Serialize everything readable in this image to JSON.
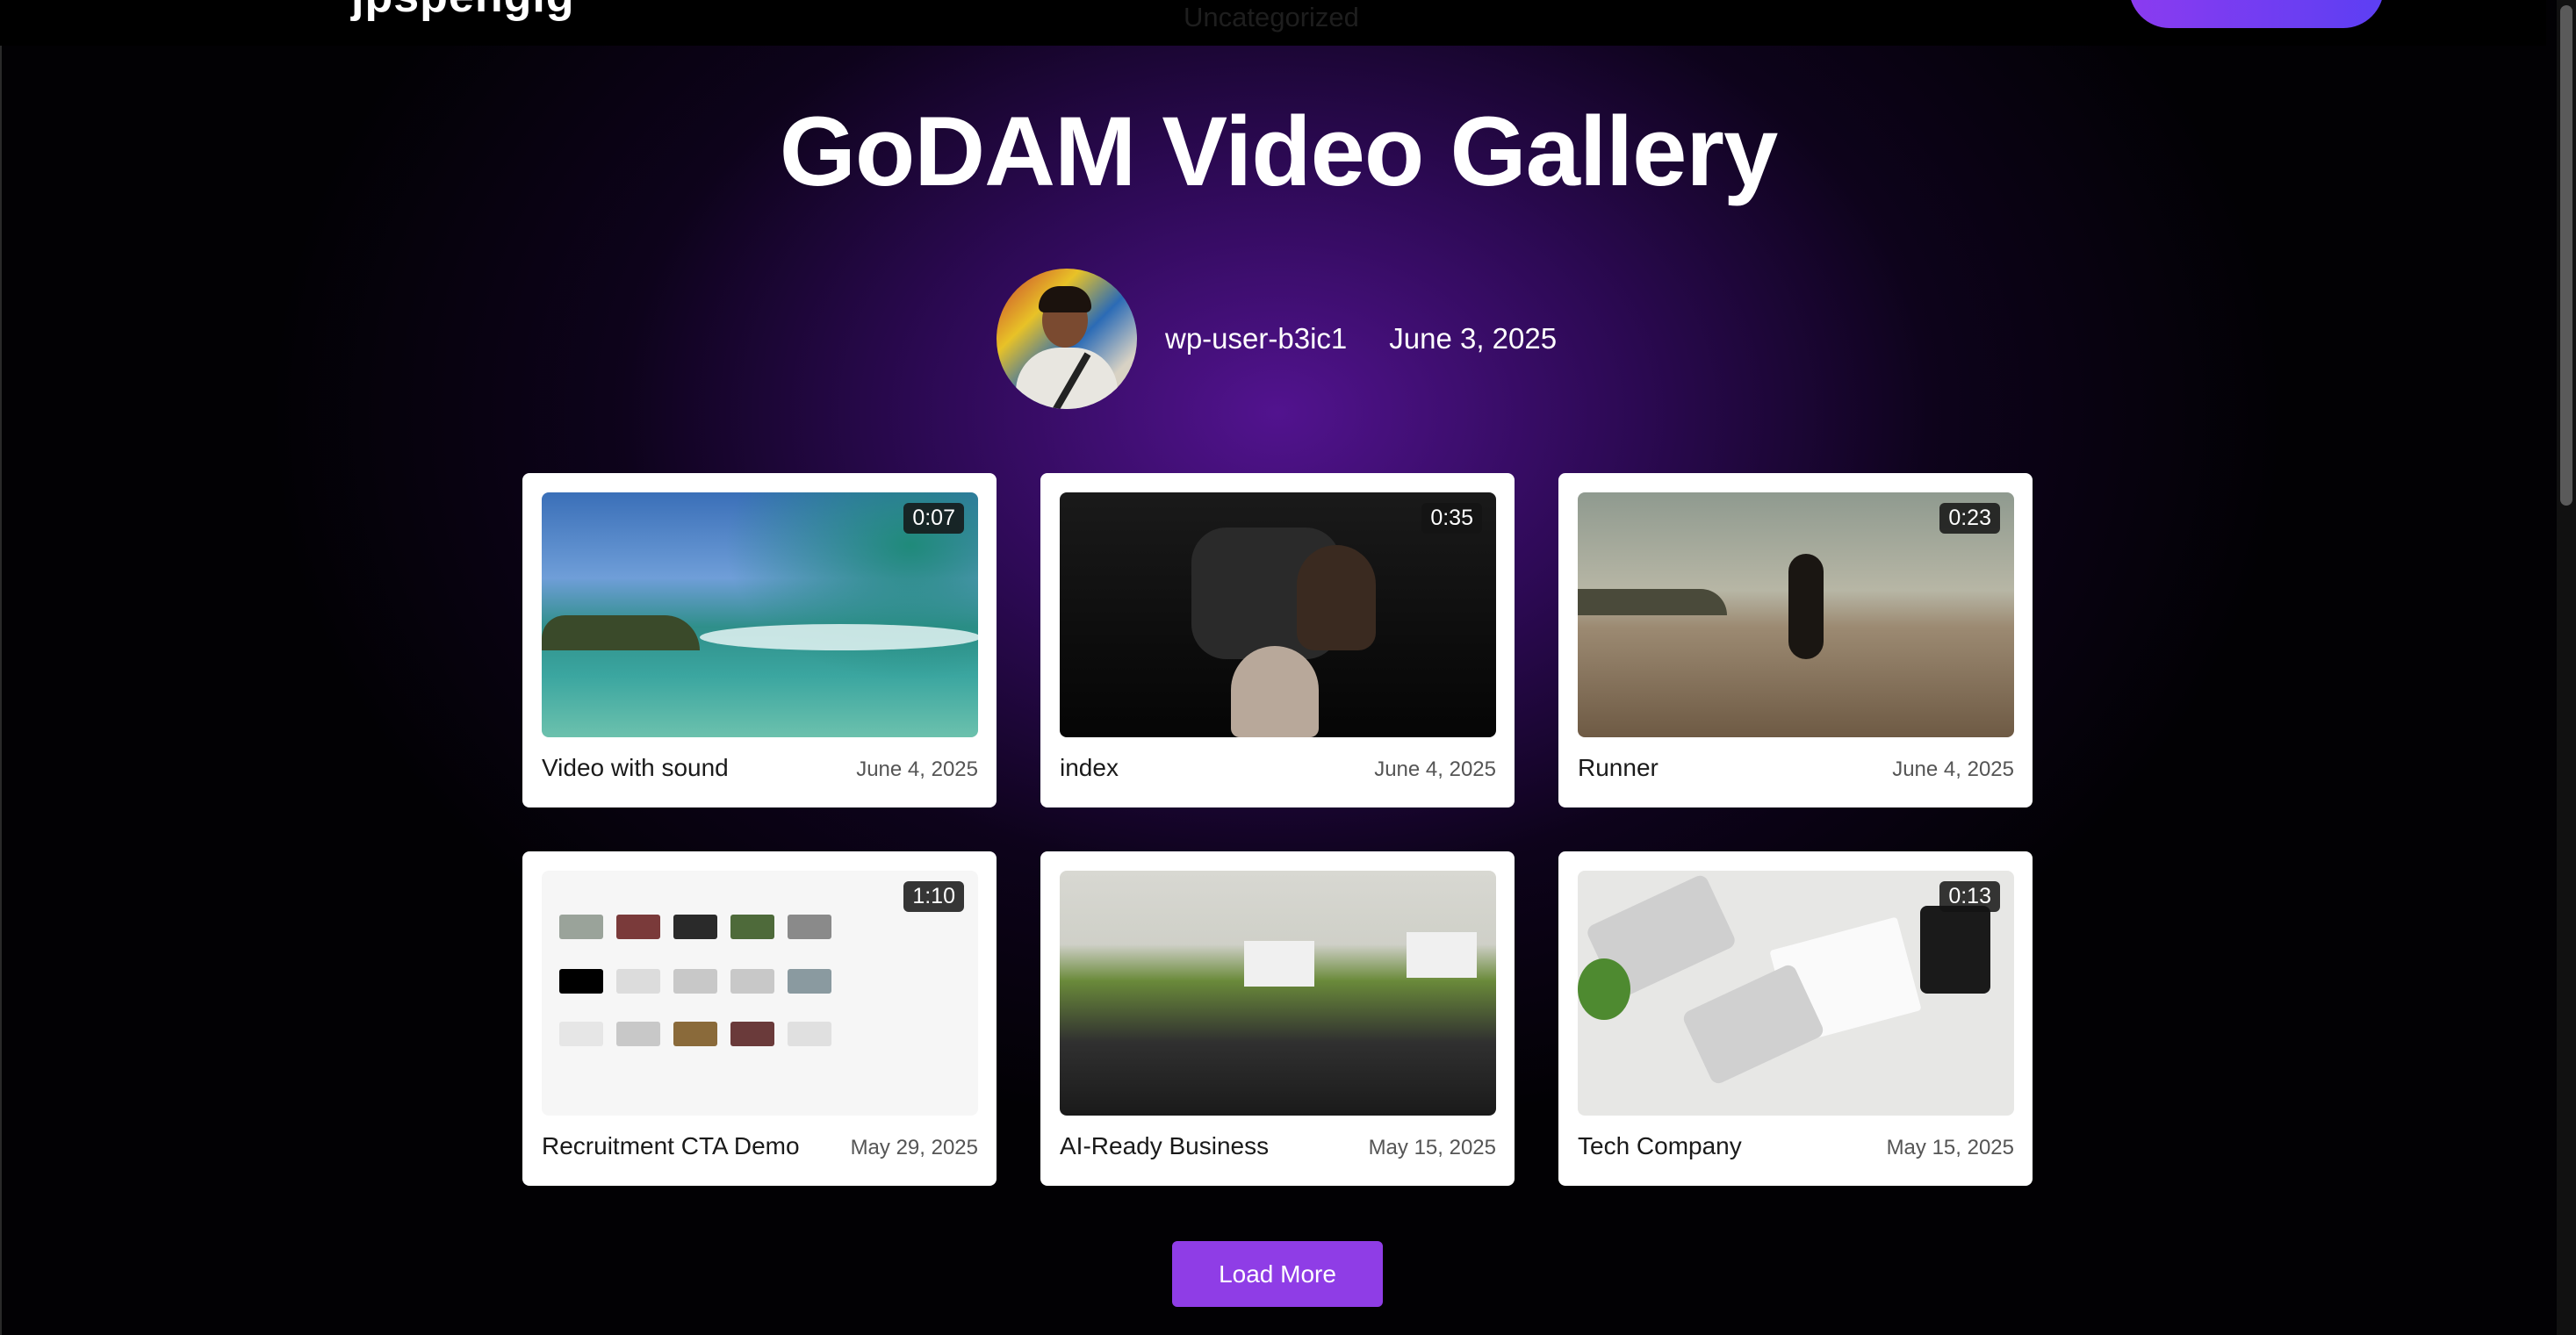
{
  "header": {
    "site_title_fragment": "jpspenglg",
    "category_fragment": "Uncategorized"
  },
  "page": {
    "title": "GoDAM Video Gallery",
    "author": {
      "name": "wp-user-b3ic1",
      "date": "June 3, 2025"
    }
  },
  "videos": [
    {
      "title": "Video with sound",
      "date": "June 4, 2025",
      "duration": "0:07",
      "thumbnail": "ocean-wave"
    },
    {
      "title": "index",
      "date": "June 4, 2025",
      "duration": "0:35",
      "thumbnail": "car-interior"
    },
    {
      "title": "Runner",
      "date": "June 4, 2025",
      "duration": "0:23",
      "thumbnail": "beach-runner"
    },
    {
      "title": "Recruitment CTA Demo",
      "date": "May 29, 2025",
      "duration": "1:10",
      "thumbnail": "video-grid-screenshot"
    },
    {
      "title": "AI-Ready Business",
      "date": "May 15, 2025",
      "duration": "",
      "thumbnail": "seminar-room"
    },
    {
      "title": "Tech Company",
      "date": "May 15, 2025",
      "duration": "0:13",
      "thumbnail": "desk-keyboards"
    }
  ],
  "load_more_label": "Load More",
  "colors": {
    "accent": "#8f3de6",
    "background_glow": "#561496"
  }
}
